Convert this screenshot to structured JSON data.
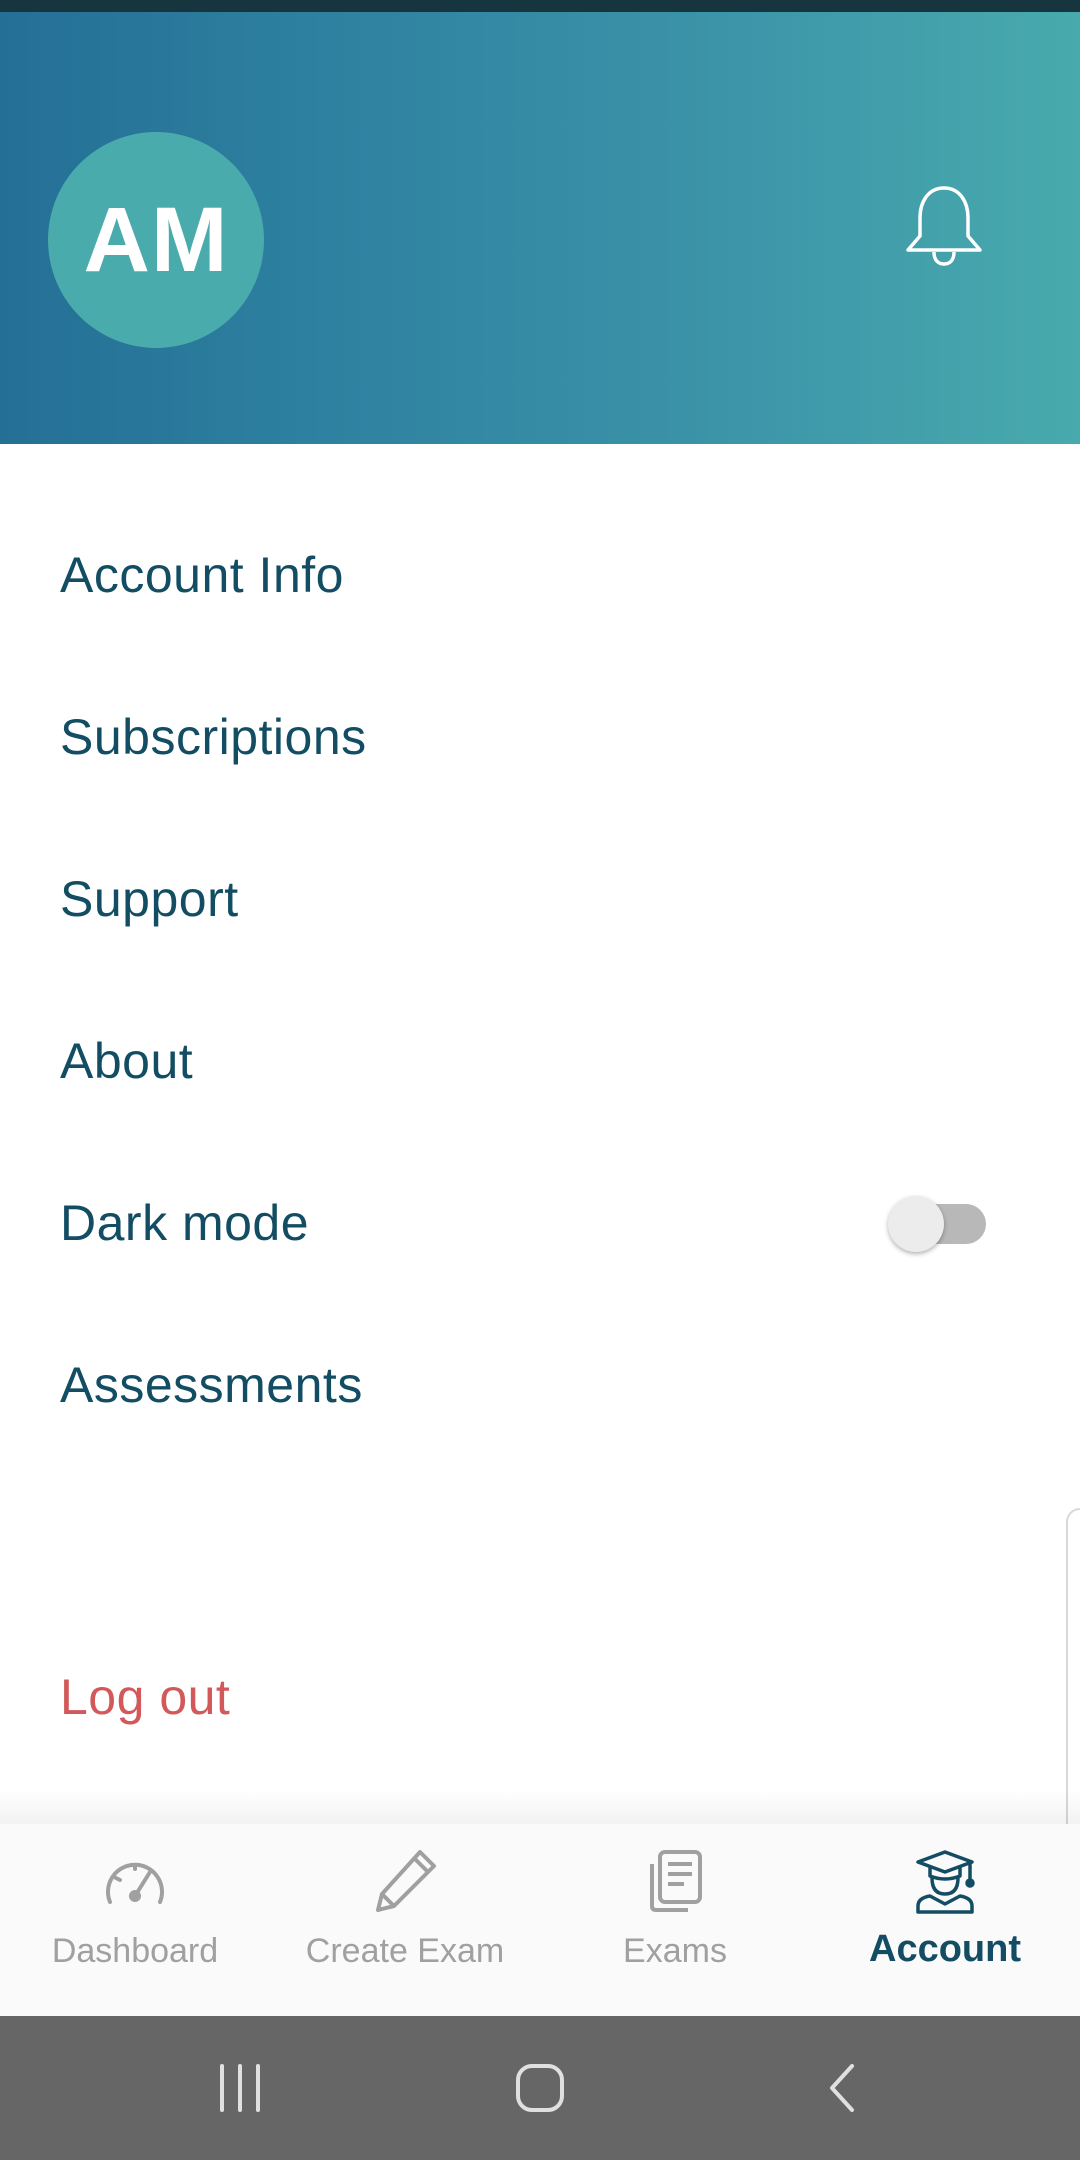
{
  "header": {
    "avatar_initials": "AM",
    "bell_icon": "bell-icon"
  },
  "menu": {
    "items": [
      {
        "label": "Account Info"
      },
      {
        "label": "Subscriptions"
      },
      {
        "label": "Support"
      },
      {
        "label": "About"
      },
      {
        "label": "Dark mode",
        "toggle_on": false
      },
      {
        "label": "Assessments"
      }
    ],
    "logout_label": "Log out"
  },
  "tabbar": {
    "tabs": [
      {
        "label": "Dashboard",
        "icon": "speedometer-icon",
        "active": false
      },
      {
        "label": "Create Exam",
        "icon": "pencil-icon",
        "active": false
      },
      {
        "label": "Exams",
        "icon": "documents-icon",
        "active": false
      },
      {
        "label": "Account",
        "icon": "graduate-icon",
        "active": true
      }
    ]
  },
  "navbar": {
    "buttons": [
      "recent-apps-icon",
      "home-icon",
      "back-icon"
    ]
  },
  "colors": {
    "primary_text": "#134d63",
    "logout": "#d2585a",
    "header_start": "#246f96",
    "header_end": "#48aaad",
    "inactive_tab": "#a0a0a0"
  }
}
